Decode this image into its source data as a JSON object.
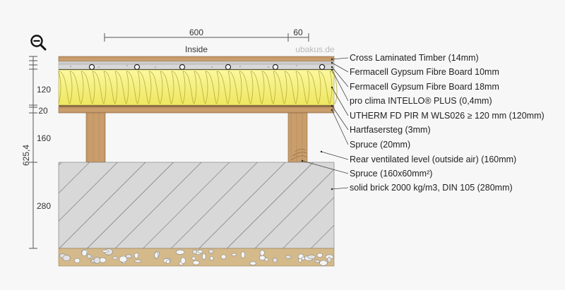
{
  "header": {
    "dim_top_left": "600",
    "dim_top_right": "60",
    "side_label": "Inside",
    "watermark": "ubakus.de"
  },
  "dims_left": {
    "d1": "120",
    "d2": "20",
    "d3": "160",
    "d4": "280",
    "total": "625,4"
  },
  "layers": [
    "Cross Laminated Timber (14mm)",
    "Fermacell Gypsum Fibre Board 10mm",
    "Fermacell Gypsum Fibre Board 18mm",
    "pro clima INTELLO® PLUS (0,4mm)",
    "UTHERM FD PIR M WLS026 ≥ 120 mm (120mm)",
    "Hartfasersteg (3mm)",
    "Spruce (20mm)",
    "Rear ventilated level (outside air) (160mm)",
    "Spruce (160x60mm²)",
    "solid brick 2000 kg/m3, DIN 105 (280mm)"
  ],
  "icons": {
    "zoom": "zoom-out-icon"
  },
  "colors": {
    "timber": "#c8a070",
    "insulation": "#f3f07a",
    "brick": "#d6d6d6",
    "gravel_bed": "#d4b98a"
  }
}
